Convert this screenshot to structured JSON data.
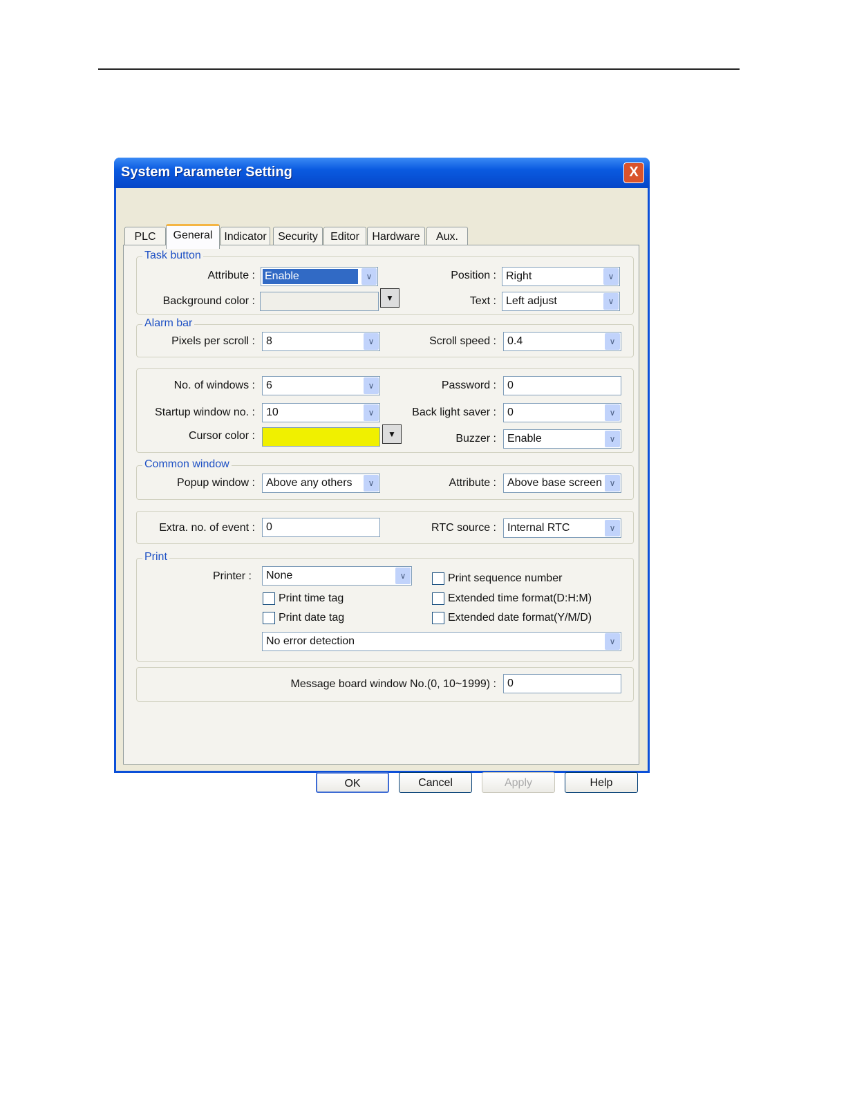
{
  "dialog": {
    "title": "System Parameter Setting",
    "close": "X"
  },
  "tabs": [
    "PLC",
    "General",
    "Indicator",
    "Security",
    "Editor",
    "Hardware",
    "Aux."
  ],
  "task_button": {
    "legend": "Task button",
    "attribute_label": "Attribute :",
    "attribute": "Enable",
    "bg_label": "Background color :",
    "position_label": "Position :",
    "position": "Right",
    "text_label": "Text :",
    "text": "Left adjust"
  },
  "alarm_bar": {
    "legend": "Alarm bar",
    "pixels_label": "Pixels per scroll :",
    "pixels": "8",
    "speed_label": "Scroll speed :",
    "speed": "0.4"
  },
  "windows": {
    "num_label": "No. of windows :",
    "num": "6",
    "startup_label": "Startup window no. :",
    "startup": "10",
    "cursor_label": "Cursor color :",
    "cursor_color": "#f0f000",
    "password_label": "Password :",
    "password": "0",
    "backlight_label": "Back light saver :",
    "backlight": "0",
    "buzzer_label": "Buzzer :",
    "buzzer": "Enable"
  },
  "common_window": {
    "legend": "Common window",
    "popup_label": "Popup window :",
    "popup": "Above any others",
    "attr_label": "Attribute :",
    "attr": "Above base screen"
  },
  "event": {
    "extra_label": "Extra. no. of event :",
    "extra": "0",
    "rtc_label": "RTC source :",
    "rtc": "Internal RTC"
  },
  "print": {
    "legend": "Print",
    "printer_label": "Printer :",
    "printer": "None",
    "time_tag": "Print time tag",
    "date_tag": "Print date tag",
    "seq": "Print sequence number",
    "ext_time": "Extended time format(D:H:M)",
    "ext_date": "Extended date format(Y/M/D)",
    "error": "No error detection"
  },
  "message": {
    "label": "Message board window No.(0, 10~1999) :",
    "value": "0"
  },
  "buttons": {
    "ok": "OK",
    "cancel": "Cancel",
    "apply": "Apply",
    "help": "Help"
  }
}
